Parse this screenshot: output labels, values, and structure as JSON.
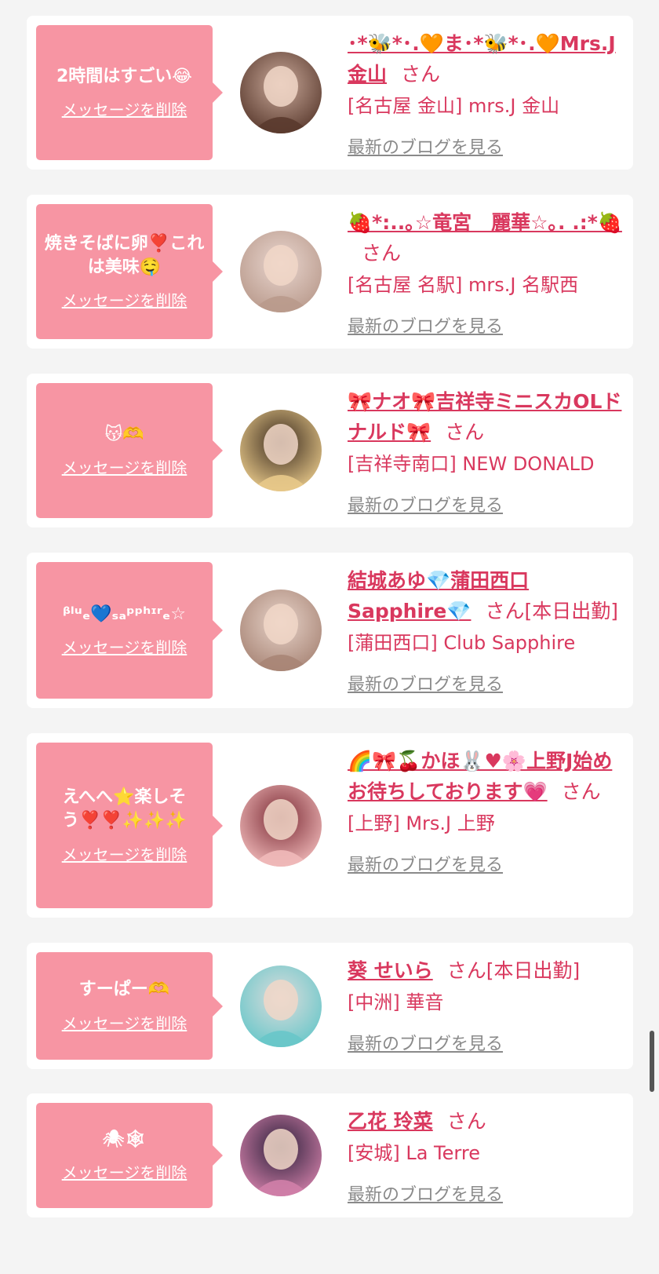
{
  "cards": [
    {
      "message": "2時間はすごい😂",
      "delete_label": "メッセージを削除",
      "name": "･*🐝*･.🧡ま･*🐝*･.🧡Mrs.J 金山",
      "san": "さん",
      "status": "",
      "shop": "[名古屋 金山] mrs.J 金山",
      "blog_label": "最新のブログを見る",
      "avatar_colors": [
        "#c9a99a",
        "#5a3a2e"
      ]
    },
    {
      "message": "焼きそばに卵❣️これは美味🤤",
      "delete_label": "メッセージを削除",
      "name": "🍓*:..｡☆竜宮　麗華☆｡. .:*🍓",
      "san": "さん",
      "status": "",
      "shop": "[名古屋 名駅] mrs.J 名駅西",
      "blog_label": "最新のブログを見る",
      "avatar_colors": [
        "#e9d6cf",
        "#b99a8c"
      ]
    },
    {
      "message": "😽🫶",
      "delete_label": "メッセージを削除",
      "name": "🎀ナオ🎀吉祥寺ミニスカOLドナルド🎀",
      "san": "さん",
      "status": "",
      "shop": "[吉祥寺南口] NEW DONALD",
      "blog_label": "最新のブログを見る",
      "avatar_colors": [
        "#3a2a1e",
        "#e8c98a"
      ]
    },
    {
      "message": "ᵝˡᵘₑ💙ₛₐᵖᵖʰᶦʳₑ☆",
      "delete_label": "メッセージを削除",
      "name": "結城あゆ💎蒲田西口Sapphire💎",
      "san": "さん",
      "status": "[本日出勤]",
      "shop": "[蒲田西口] Club Sapphire",
      "blog_label": "最新のブログを見る",
      "avatar_colors": [
        "#e7d3c9",
        "#a88576"
      ]
    },
    {
      "message": "えへへ⭐️楽しそう❣️❣️✨✨✨",
      "delete_label": "メッセージを削除",
      "name": "🌈🎀🍒かほ🐰♥🌸上野J始めお待ちしております💗",
      "san": "さん",
      "status": "",
      "shop": "[上野] Mrs.J 上野",
      "blog_label": "最新のブログを見る",
      "avatar_colors": [
        "#7a2a34",
        "#f0b9b9"
      ]
    },
    {
      "message": "すーぱー🫶",
      "delete_label": "メッセージを削除",
      "name": "葵 せいら",
      "san": "さん",
      "status": "[本日出勤]",
      "shop": "[中洲] 華音",
      "blog_label": "最新のブログを見る",
      "avatar_colors": [
        "#dcdcdc",
        "#68c7c9"
      ]
    },
    {
      "message": "🕷🕸",
      "delete_label": "メッセージを削除",
      "name": "乙花 玲菜",
      "san": "さん",
      "status": "",
      "shop": "[安城] La Terre",
      "blog_label": "最新のブログを見る",
      "avatar_colors": [
        "#2b1f3a",
        "#d07fa8"
      ]
    }
  ]
}
